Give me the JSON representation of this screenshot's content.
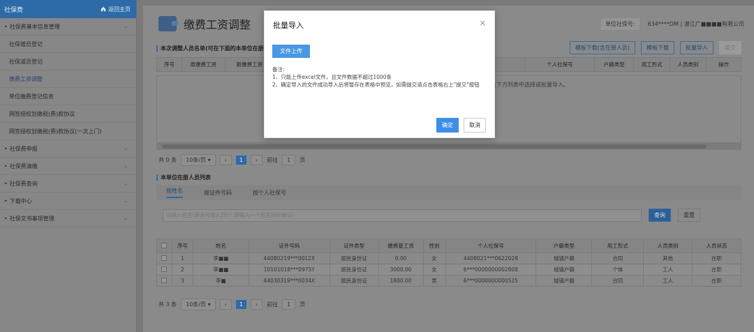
{
  "sidebar": {
    "title": "社保费",
    "home_label": "返回主页",
    "items": [
      {
        "label": "社保费基本信息管理",
        "type": "group"
      },
      {
        "label": "社保增员登记",
        "type": "sub"
      },
      {
        "label": "社保减员登记",
        "type": "sub"
      },
      {
        "label": "缴费工资调整",
        "type": "sub",
        "active": true
      },
      {
        "label": "单位缴费登记信息",
        "type": "sub"
      },
      {
        "label": "网签授权划缴税(费)款协议",
        "type": "sub"
      },
      {
        "label": "网签授权划缴税(费)款协议(一次上门)",
        "type": "sub"
      },
      {
        "label": "社保费申报",
        "type": "group"
      },
      {
        "label": "社保费清缴",
        "type": "group"
      },
      {
        "label": "社保费查询",
        "type": "group"
      },
      {
        "label": "下载中心",
        "type": "group"
      },
      {
        "label": "社保文书事项管理",
        "type": "group"
      }
    ]
  },
  "header": {
    "title": "缴费工资调整",
    "unit_label": "单位社保号:",
    "unit_value": "634****DM | 湛江广■■■■有限公司"
  },
  "section1": {
    "title": "本次调整人员名单(可在下面的本单位在册人员列表中选择)",
    "buttons": [
      "模板下载(含在册人员)",
      "模板下载",
      "批量导入",
      "提交"
    ],
    "columns": [
      "序号",
      "原缴费工资",
      "新缴费工资",
      "个人社保号",
      "户籍类型",
      "用工形式",
      "人员类别",
      "操作"
    ],
    "empty_hint": "请在下方列表中选择或批量导入。",
    "pager": {
      "total": "共 0 条",
      "per_page": "10条/页",
      "page": "1",
      "goto_label": "前往",
      "goto_value": "1",
      "goto_unit": "页"
    }
  },
  "section2": {
    "title": "本单位在册人员列表",
    "tabs": [
      "按姓名",
      "按证件号码",
      "按个人社保号"
    ],
    "search_placeholder": "请输入姓名(最多可输入20个,每输入一个姓名回车确认)",
    "search_label": "查询",
    "reset_label": "重置",
    "columns": [
      "",
      "序号",
      "姓名",
      "证件号码",
      "证件类型",
      "缴费基工资",
      "性别",
      "个人社保号",
      "户籍类型",
      "用工形式",
      "人员类别",
      "人员状态"
    ],
    "rows": [
      [
        "",
        "1",
        "李■■",
        "44080219***0012X",
        "居民身份证",
        "0.00",
        "女",
        "4408021***0622028",
        "城镇户籍",
        "合同",
        "其他",
        "在职"
      ],
      [
        "",
        "2",
        "李■■",
        "10101018***0975Y",
        "居民身份证",
        "3000.00",
        "女",
        "6***0000000002808",
        "城镇户籍",
        "个体",
        "工人",
        "在职"
      ],
      [
        "",
        "3",
        "李■",
        "44030319***0034X",
        "居民身份证",
        "1800.00",
        "男",
        "6***0000000000525",
        "城镇户籍",
        "合同",
        "工人",
        "在职"
      ]
    ],
    "pager": {
      "total": "共 3 条",
      "per_page": "10条/页",
      "page": "1",
      "goto_label": "前往",
      "goto_value": "1",
      "goto_unit": "页"
    }
  },
  "modal": {
    "title": "批量导入",
    "upload_label": "文件上传",
    "note_title": "备注:",
    "note_lines": [
      "1、只能上传excel文件，且文件数据不超过1000条",
      "2、确定导入的文件成功导入后将暂存在表格中预览，如需提交请点击表格右上\"提交\"按钮"
    ],
    "ok_label": "确定",
    "cancel_label": "取消"
  },
  "colors": {
    "primary": "#2d6aa8",
    "modal_button": "#3c8ee6",
    "dim_background": "#878787"
  }
}
